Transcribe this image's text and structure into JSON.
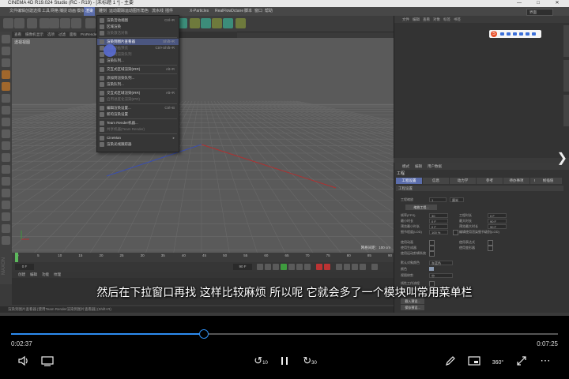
{
  "app": {
    "title": "CINEMA 4D R19.024 Studio (RC - R19) - [未标题 1 *] - 主要",
    "window_buttons": [
      "—",
      "□",
      "✕"
    ]
  },
  "menubar": {
    "items": [
      "文件",
      "编辑",
      "创建",
      "选择",
      "工具",
      "网格",
      "捕捉",
      "动画",
      "模拟",
      "渲染",
      "雕刻",
      "运动跟踪",
      "运动图形",
      "角色",
      "流水线",
      "插件",
      "X-Particles",
      "RealFlow",
      "Octane",
      "脚本",
      "窗口",
      "帮助"
    ],
    "active_item": "渲染",
    "layout_label": "界面"
  },
  "view_menu": [
    "查看",
    "摄像机",
    "显示",
    "选项",
    "过滤",
    "面板",
    "ProRender"
  ],
  "viewport": {
    "label": "透视视图",
    "grid_size": "网格间距：100 cm"
  },
  "render_menu": [
    {
      "label": "渲染活动视图",
      "shortcut": "Ctrl+R"
    },
    {
      "label": "区域渲染",
      "shortcut": ""
    },
    {
      "label": "渲染激活对象",
      "shortcut": "",
      "dim": true
    },
    {
      "sep": true
    },
    {
      "label": "渲染到图片查看器",
      "shortcut": "Shift+R"
    },
    {
      "label": "创建动画预览",
      "shortcut": "Ctrl+Shift+R",
      "dim": true
    },
    {
      "label": "添加到渲染队列",
      "shortcut": "",
      "dim": true
    },
    {
      "label": "渲染队列...",
      "shortcut": ""
    },
    {
      "sep": true
    },
    {
      "label": "交互式区域渲染(IRR)",
      "shortcut": "Alt+R"
    },
    {
      "sep": true
    },
    {
      "label": "添加到渲染队列...",
      "shortcut": ""
    },
    {
      "label": "渲染队列...",
      "shortcut": ""
    },
    {
      "sep": true
    },
    {
      "label": "交互式区域渲染(IRR)",
      "shortcut": "Alt+R"
    },
    {
      "label": "启用进度化渲染(IPR)",
      "shortcut": "",
      "dim": true
    },
    {
      "sep": true
    },
    {
      "label": "编辑渲染设置...",
      "shortcut": "Ctrl+B"
    },
    {
      "label": "新的渲染设置",
      "shortcut": ""
    },
    {
      "sep": true
    },
    {
      "label": "Team Render机器...",
      "shortcut": ""
    },
    {
      "label": "共享机器(Team Render)",
      "shortcut": "",
      "dim": true
    },
    {
      "sep": true
    },
    {
      "label": "CineMan",
      "shortcut": "▸"
    },
    {
      "label": "渲染光线跟踪器",
      "shortcut": ""
    }
  ],
  "timeline": {
    "ticks": [
      "0",
      "5",
      "10",
      "15",
      "20",
      "25",
      "30",
      "35",
      "40",
      "45",
      "50",
      "55",
      "60",
      "65",
      "70",
      "75",
      "80",
      "85",
      "90"
    ],
    "start_frame": "0 F",
    "end_frame": "90 F",
    "current_frame": "0 F"
  },
  "material_menu": [
    "创建",
    "编辑",
    "功能",
    "纹理"
  ],
  "statusbar": {
    "text": "渲染到图片查看器 [使用Team Render渲染到图片查看器] (Shift+R)"
  },
  "object_panel": {
    "menu": [
      "文件",
      "编辑",
      "查看",
      "对象",
      "标签",
      "书签"
    ]
  },
  "attributes": {
    "menu": [
      "模式",
      "编辑",
      "用户数据"
    ],
    "title": "工程",
    "tabs": [
      "工程设置",
      "信息",
      "动力学",
      "参考",
      "待办事项",
      "Octane Render"
    ],
    "active_tab": "工程设置",
    "extra_tab": "帧插值",
    "section": "工程设置",
    "fields": [
      {
        "label": "工程缩放",
        "value": "1",
        "unit": "厘米"
      },
      {
        "label": "帧率(FPS)",
        "value": "30"
      },
      {
        "label": "工程时长",
        "value": "0 F"
      },
      {
        "label": "最小时长",
        "value": "0 F"
      },
      {
        "label": "最大时长",
        "value": "90 F"
      },
      {
        "label": "预览最小时长",
        "value": "0 F"
      },
      {
        "label": "预览最大时长",
        "value": "90 F"
      },
      {
        "label": "细节程度(LOD)",
        "value": "100 %"
      }
    ],
    "scale_button": "缩放工程...",
    "lod_check_label": "编辑使用渲染细节级别(LOD)",
    "checks": [
      "使用动画",
      "使用表达式",
      "使用生成器",
      "使用变形器",
      "使用运动剪辑系统"
    ],
    "default_color_label": "默认对象颜色",
    "default_color_value": "灰蓝色",
    "color_label": "颜色",
    "view_clip_label": "视图修剪",
    "view_clip_value": "中",
    "linear_label": "线性工作流程",
    "input_color_label": "输入色彩特性",
    "input_color_value": "sRGB",
    "load_button": "载入预设...",
    "save_button": "保存预设..."
  },
  "subtitle": "然后在下拉窗口再找 这样比较麻烦 所以呢 它就会多了一个模块叫常用菜单栏",
  "player": {
    "current_time": "0:02:37",
    "total_time": "0:07:25",
    "progress": 0.3528,
    "skip_back": "10",
    "skip_forward": "30",
    "accent": "#2d8cf0"
  }
}
